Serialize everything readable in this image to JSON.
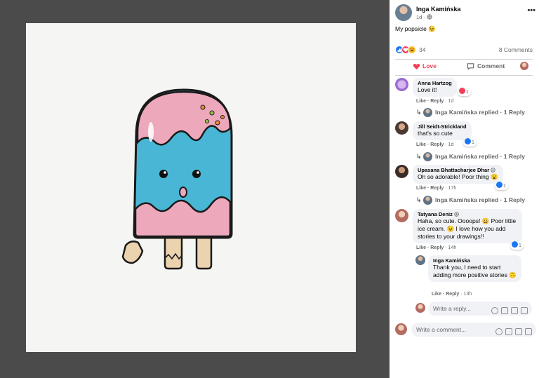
{
  "post": {
    "author": "Inga Kamińska",
    "time": "1d · ",
    "privacy_icon": "globe-icon",
    "caption": "My popsicle 😉",
    "more_label": "•••"
  },
  "reactions": {
    "icons": [
      "like-icon",
      "love-icon",
      "haha-icon"
    ],
    "count": "34",
    "comments_label": "8 Comments"
  },
  "actions": {
    "love_label": "Love",
    "comment_label": "Comment"
  },
  "comments": [
    {
      "name": "Anna Hartzog",
      "text": "Love it!",
      "like": "Like",
      "reply": "Reply",
      "time": "1d",
      "reaction_count": "1"
    },
    {
      "name": "Jill Seidt-Strickland",
      "text": "that's so cute",
      "like": "Like",
      "reply": "Reply",
      "time": "1d",
      "reaction_count": "1"
    },
    {
      "name": "Upasana Bhattacharjee Dhar",
      "text": "Oh so adorable! Poor thing 😮",
      "like": "Like",
      "reply": "Reply",
      "time": "17h",
      "reaction_count": "1"
    },
    {
      "name": "Tatyana Deniz",
      "text": "Haha, so cute. Oooops! 😀 Poor little ice cream. 😉 I love how you add stories to your drawings!!",
      "like": "Like",
      "reply": "Reply",
      "time": "14h",
      "reaction_count": "1"
    }
  ],
  "replies_summary": "Inga Kamińska replied · 1 Reply",
  "nested_reply": {
    "name": "Inga Kamińska",
    "text": "Thank you, I need to start adding more positive stories 🙃",
    "like": "Like",
    "reply": "Reply",
    "time": "13h"
  },
  "composer": {
    "reply_placeholder": "Write a reply...",
    "comment_placeholder": "Write a comment..."
  },
  "link_separator": " · "
}
